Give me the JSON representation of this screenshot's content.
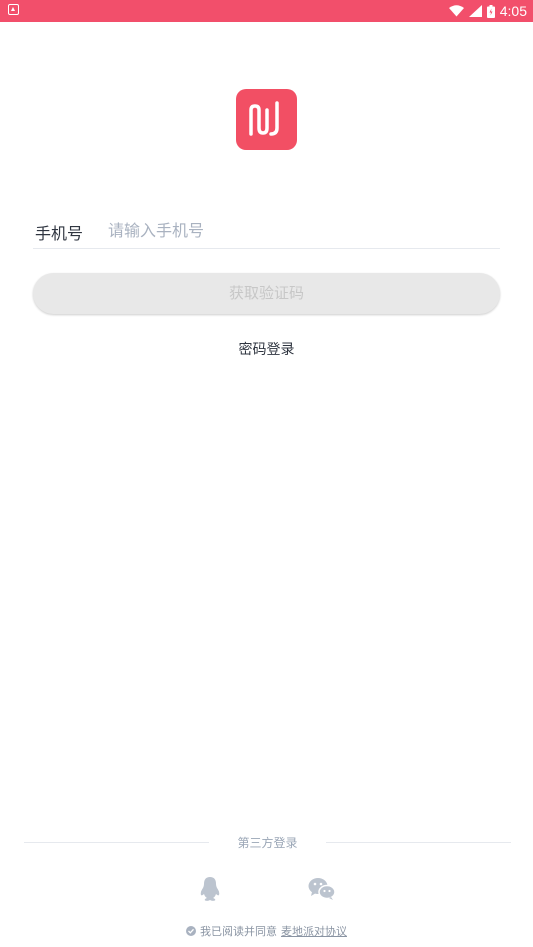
{
  "statusbar": {
    "time": "4:05"
  },
  "form": {
    "phone_label": "手机号",
    "phone_placeholder": "请输入手机号",
    "phone_value": "",
    "get_code_label": "获取验证码",
    "password_login_label": "密码登录"
  },
  "third_party": {
    "title": "第三方登录"
  },
  "agreement": {
    "prefix": "我已阅读并同意",
    "link": "麦地派对协议"
  },
  "colors": {
    "brand": "#f24f64",
    "statusbar": "#f24f6b"
  },
  "icons": [
    "app-logo-icon",
    "qq-icon",
    "wechat-icon",
    "check-icon",
    "wifi-icon",
    "signal-icon",
    "battery-icon"
  ]
}
